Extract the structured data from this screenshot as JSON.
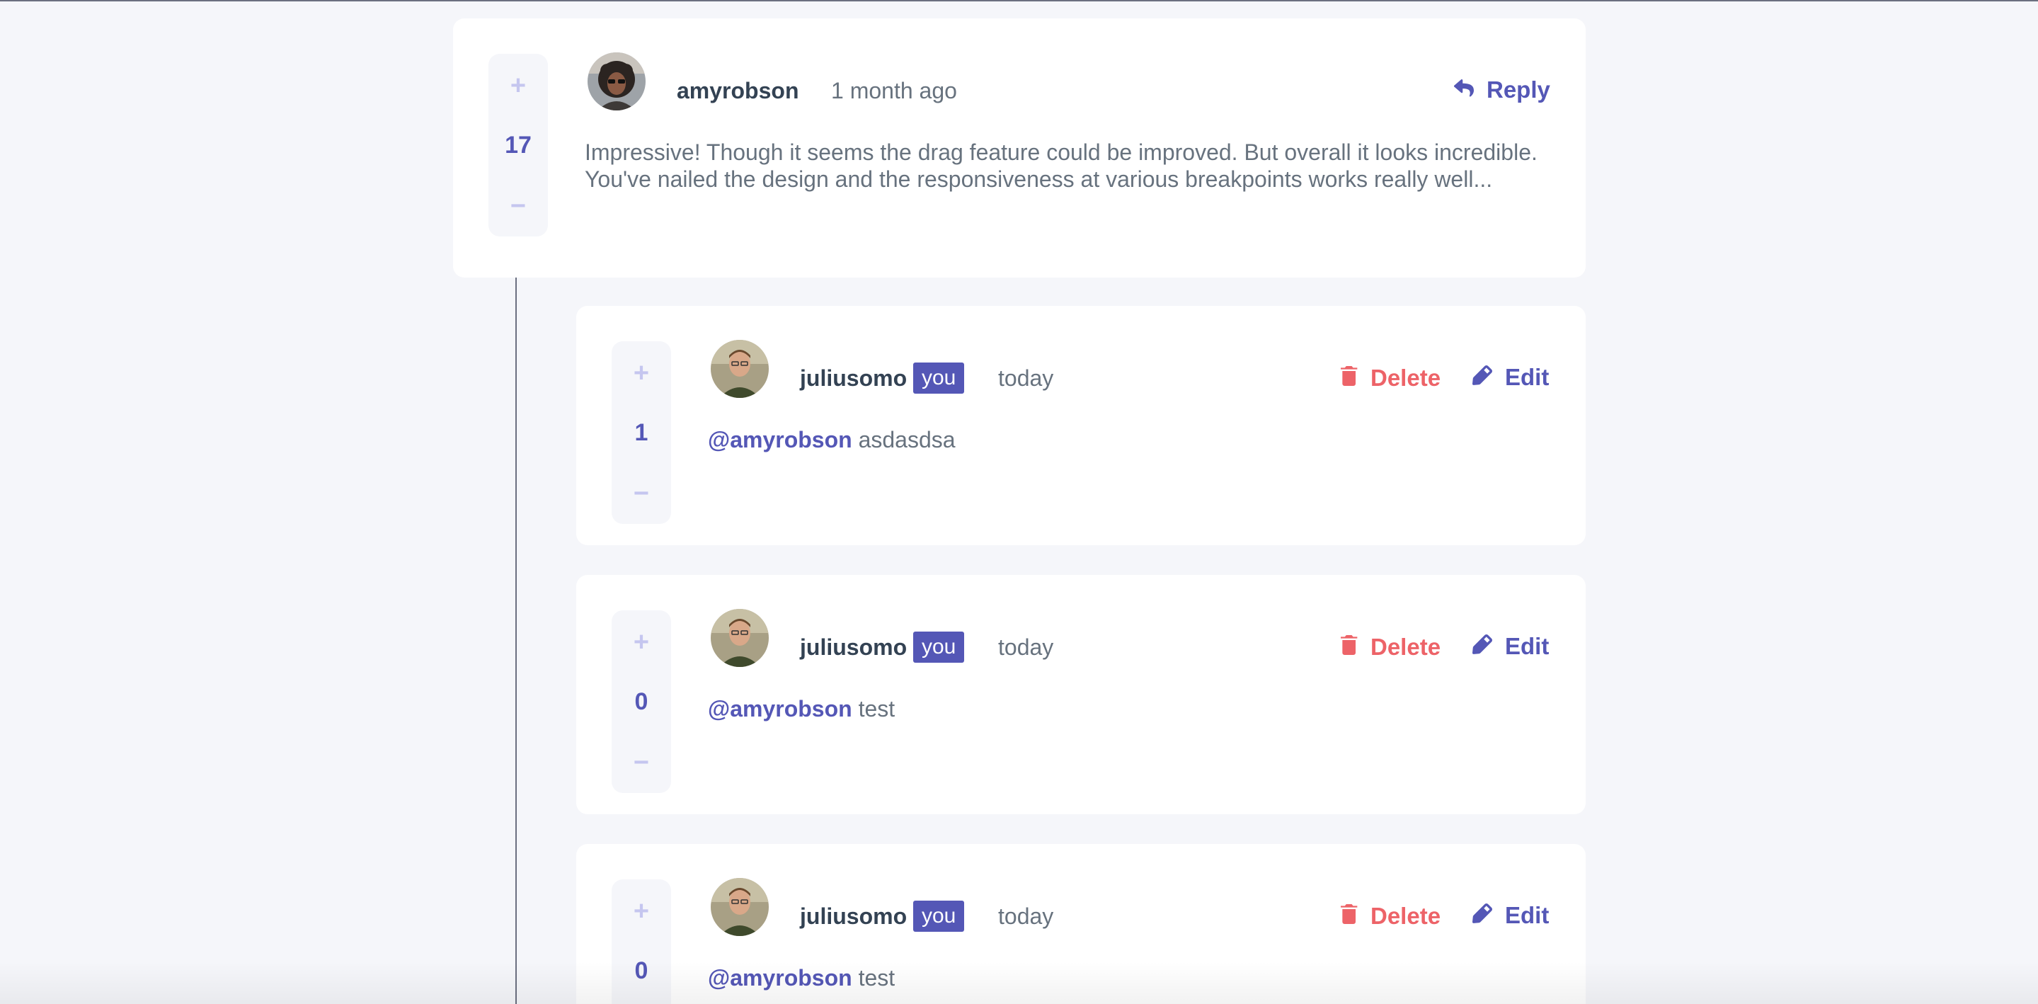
{
  "comment": {
    "score": "17",
    "vote_up": "+",
    "vote_down": "−",
    "username": "amyrobson",
    "timestamp": "1 month ago",
    "reply_label": "Reply",
    "content": "Impressive! Though it seems the drag feature could be improved. But overall it looks incredible. You've nailed the design and the responsiveness at various breakpoints works really well..."
  },
  "replies": [
    {
      "score": "1",
      "vote_up": "+",
      "vote_down": "−",
      "username": "juliusomo",
      "badge": "you",
      "timestamp": "today",
      "delete_label": "Delete",
      "edit_label": "Edit",
      "mention": "@amyrobson",
      "content": "asdasdsa"
    },
    {
      "score": "0",
      "vote_up": "+",
      "vote_down": "−",
      "username": "juliusomo",
      "badge": "you",
      "timestamp": "today",
      "delete_label": "Delete",
      "edit_label": "Edit",
      "mention": "@amyrobson",
      "content": "test"
    },
    {
      "score": "0",
      "vote_up": "+",
      "vote_down": "−",
      "username": "juliusomo",
      "badge": "you",
      "timestamp": "today",
      "delete_label": "Delete",
      "edit_label": "Edit",
      "mention": "@amyrobson",
      "content": "test"
    }
  ],
  "colors": {
    "accent": "#5457b6",
    "danger": "#ed6368",
    "muted_vote": "#c5c6ef",
    "text_dark": "#334253",
    "text_muted": "#67727e",
    "background": "#f5f6fa"
  },
  "icons": [
    "reply-icon",
    "trash-icon",
    "pencil-icon"
  ]
}
